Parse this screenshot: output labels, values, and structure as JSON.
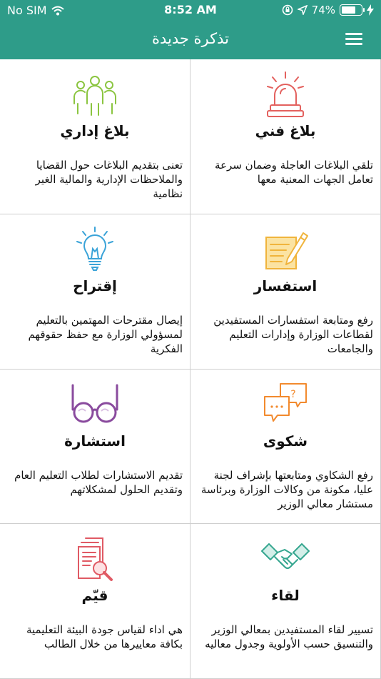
{
  "statusbar": {
    "carrier": "No SIM",
    "time": "8:52 AM",
    "battery_text": "74%",
    "battery_level": 0.74
  },
  "navbar": {
    "title": "تذكرة جديدة"
  },
  "colors": {
    "brand": "#2e9c89"
  },
  "cards": [
    {
      "title": "بلاغ فني",
      "icon": "alarm-light-icon",
      "desc": "تلقي البلاغات العاجلة وضمان سرعة تعامل الجهات المعنية معها"
    },
    {
      "title": "بلاغ إداري",
      "icon": "people-group-icon",
      "desc": "تعنى بتقديم البلاغات حول القضايا والملاحظات الإدارية والمالية الغير نظامية"
    },
    {
      "title": "استفسار",
      "icon": "note-pencil-icon",
      "desc": "رفع ومتابعة استفسارات المستفيدين لقطاعات الوزارة وإدارات التعليم والجامعات"
    },
    {
      "title": "إقتراح",
      "icon": "lightbulb-icon",
      "desc": "إيصال مقترحات المهتمين بالتعليم لمسؤولي الوزارة مع حفظ حقوقهم الفكرية"
    },
    {
      "title": "شكوى",
      "icon": "chat-bubbles-icon",
      "desc": "رفع الشكاوي ومتابعتها بإشراف لجنة عليا، مكونة من وكالات الوزارة وبرئاسة مستشار معالي الوزير"
    },
    {
      "title": "استشارة",
      "icon": "glasses-icon",
      "desc": "تقديم الاستشارات لطلاب التعليم العام وتقديم الحلول لمشكلاتهم"
    },
    {
      "title": "لقاء",
      "icon": "handshake-icon",
      "desc": "تسيير لقاء المستفيدين بمعالي الوزير والتنسيق حسب الأولوية وجدول معاليه"
    },
    {
      "title": "قيّم",
      "icon": "document-magnifier-icon",
      "desc": "هي اداء لقياس جودة البيئة التعليمية بكافة معاييرها من خلال الطالب"
    }
  ]
}
